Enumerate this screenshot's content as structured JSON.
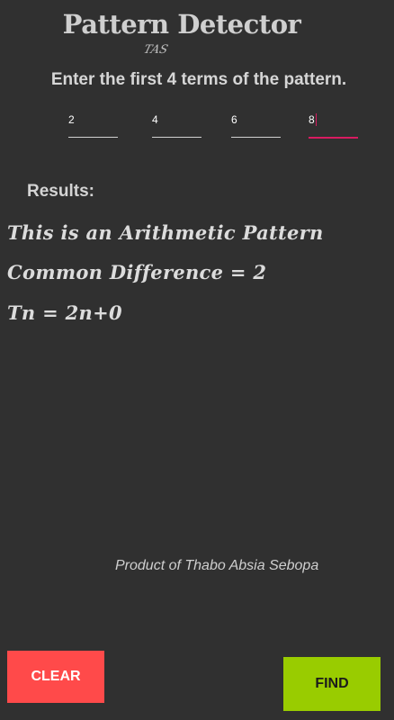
{
  "header": {
    "title": "Pattern Detector",
    "signature": "TAS"
  },
  "prompt": "Enter the first 4 terms of the pattern.",
  "terms": [
    {
      "value": "2"
    },
    {
      "value": "4"
    },
    {
      "value": "6"
    },
    {
      "value": "8"
    }
  ],
  "results": {
    "label": "Results:",
    "lines": [
      "This is an Arithmetic Pattern",
      "Common Difference = 2",
      "Tn = 2n+0"
    ]
  },
  "footer": {
    "credit": "Product of Thabo Absia Sebopa"
  },
  "buttons": {
    "clear_label": "CLEAR",
    "find_label": "FIND"
  },
  "colors": {
    "background": "#303030",
    "accent": "#d81b60",
    "clear_button": "#ff4a4a",
    "find_button": "#99cc00"
  }
}
